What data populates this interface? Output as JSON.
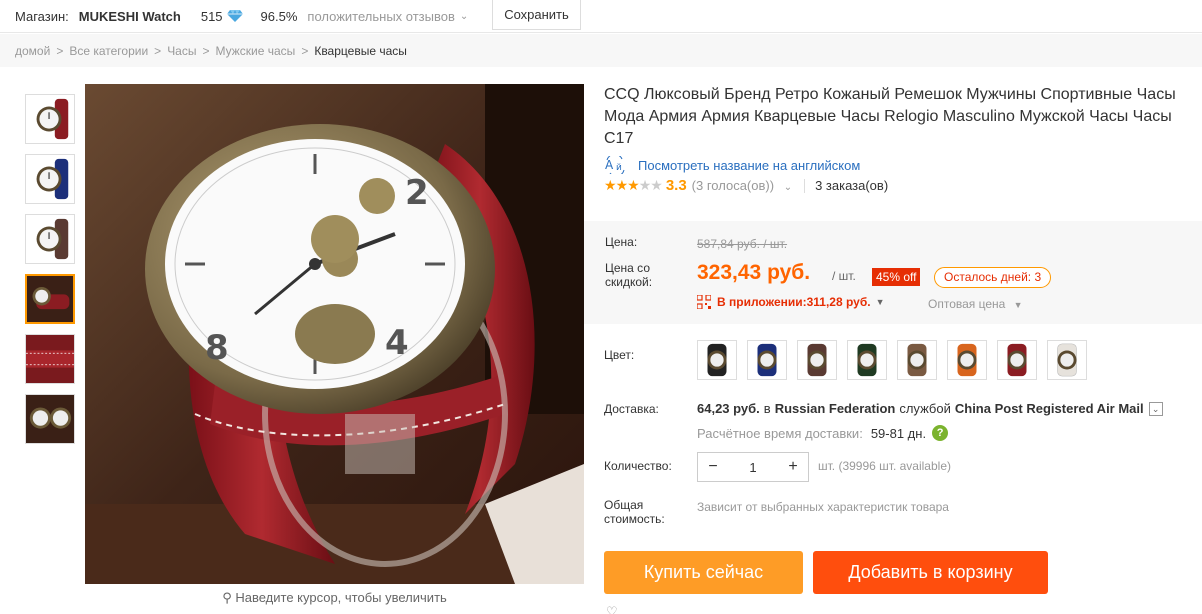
{
  "store": {
    "label": "Магазин:",
    "name": "MUKESHI Watch",
    "score": "515",
    "positive_pct": "96.5%",
    "feedback_label": "положительных отзывов",
    "save_label": "Сохранить"
  },
  "breadcrumb": {
    "items": [
      "домой",
      "Все категории",
      "Часы",
      "Мужские часы"
    ],
    "current": "Кварцевые часы",
    "separator": ">"
  },
  "gallery": {
    "zoom_hint": "Наведите курсор, чтобы увеличить",
    "thumb_count": 6,
    "active_thumb": 4
  },
  "product": {
    "title": "CCQ Люксовый Бренд Ретро Кожаный Ремешок Мужчины Спортивные Часы Мода Армия Армия Кварцевые Часы Relogio Masculino Мужской Часы Часы C17",
    "translate_link": "Посмотреть название на английском",
    "rating": "3.3",
    "rating_stars": 3.3,
    "votes": "(3 голоса(ов))",
    "orders": "3 заказа(ов)"
  },
  "price": {
    "label_price": "Цена:",
    "old_price": "587,84 руб. / шт.",
    "label_discount": "Цена со скидкой:",
    "new_price": "323,43 руб.",
    "unit": "/ шт.",
    "discount_badge": "45% off",
    "days_left": "Осталось дней: 3",
    "app_price": "В приложении:311,28 руб.",
    "wholesale": "Оптовая цена"
  },
  "color": {
    "label": "Цвет:",
    "swatch_count": 8
  },
  "shipping": {
    "label": "Доставка:",
    "cost": "64,23 руб.",
    "to_text": "в",
    "country": "Russian Federation",
    "via_text": "службой",
    "carrier": "China Post Registered Air Mail",
    "eta_label": "Расчётное время доставки:",
    "eta_days": "59-81 дн.",
    "help": "?"
  },
  "quantity": {
    "label": "Количество:",
    "value": "1",
    "minus": "−",
    "plus": "+",
    "available": "шт. (39996 шт. available)"
  },
  "total": {
    "label": "Общая стоимость:",
    "value": "Зависит от выбранных характеристик товара"
  },
  "actions": {
    "buy_now": "Купить сейчас",
    "add_to_cart": "Добавить в корзину"
  },
  "colors": {
    "accent_orange": "#ff6400",
    "red": "#e62e04",
    "link_blue": "#2a6fbf",
    "buy_now_bg": "#fe9c26",
    "add_cart_bg": "#ff4e0d"
  }
}
